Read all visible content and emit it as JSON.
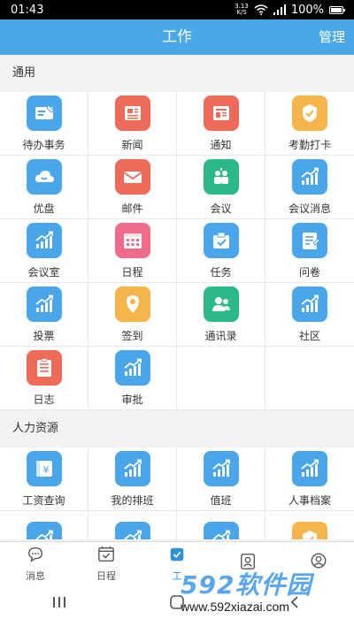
{
  "status": {
    "time": "01:43",
    "speed_value": "3.13",
    "speed_unit": "K/S",
    "battery": "100%",
    "battery_level": 1.0
  },
  "header": {
    "title": "工作",
    "manage_label": "管理"
  },
  "sections": [
    {
      "title": "通用",
      "items": [
        {
          "label": "待办事务",
          "icon": "todo-card-icon",
          "color": "#4aa6e8"
        },
        {
          "label": "新闻",
          "icon": "news-icon",
          "color": "#ee6b5a"
        },
        {
          "label": "通知",
          "icon": "notice-icon",
          "color": "#ee6b5a"
        },
        {
          "label": "考勤打卡",
          "icon": "checkin-icon",
          "color": "#f6b54a"
        },
        {
          "label": "优盘",
          "icon": "cloud-icon",
          "color": "#4aa6e8"
        },
        {
          "label": "邮件",
          "icon": "mail-icon",
          "color": "#ee6b5a"
        },
        {
          "label": "会议",
          "icon": "meeting-icon",
          "color": "#2db88a"
        },
        {
          "label": "会议消息",
          "icon": "chart-icon",
          "color": "#4aa6e8"
        },
        {
          "label": "会议室",
          "icon": "chart-icon",
          "color": "#4aa6e8"
        },
        {
          "label": "日程",
          "icon": "calendar-icon",
          "color": "#ee6b8a"
        },
        {
          "label": "任务",
          "icon": "task-icon",
          "color": "#4aa6e8"
        },
        {
          "label": "问卷",
          "icon": "survey-icon",
          "color": "#4aa6e8"
        },
        {
          "label": "投票",
          "icon": "chart-icon",
          "color": "#4aa6e8"
        },
        {
          "label": "签到",
          "icon": "location-icon",
          "color": "#f6b54a"
        },
        {
          "label": "通讯录",
          "icon": "contacts-icon",
          "color": "#2db88a"
        },
        {
          "label": "社区",
          "icon": "chart-icon",
          "color": "#4aa6e8"
        },
        {
          "label": "日志",
          "icon": "log-icon",
          "color": "#ee6b5a"
        },
        {
          "label": "审批",
          "icon": "chart-icon",
          "color": "#4aa6e8"
        }
      ]
    },
    {
      "title": "人力资源",
      "items": [
        {
          "label": "工资查询",
          "icon": "salary-icon",
          "color": "#4aa6e8"
        },
        {
          "label": "我的排班",
          "icon": "chart-icon",
          "color": "#4aa6e8"
        },
        {
          "label": "值班",
          "icon": "chart-icon",
          "color": "#4aa6e8"
        },
        {
          "label": "人事档案",
          "icon": "chart-icon",
          "color": "#4aa6e8"
        },
        {
          "label": "",
          "icon": "chart-icon",
          "color": "#4aa6e8"
        },
        {
          "label": "",
          "icon": "chart-icon",
          "color": "#4aa6e8"
        },
        {
          "label": "",
          "icon": "chart-icon",
          "color": "#4aa6e8"
        },
        {
          "label": "",
          "icon": "checkin-icon",
          "color": "#f6b54a"
        }
      ]
    }
  ],
  "tabs": [
    {
      "label": "消息",
      "icon": "message-icon",
      "active": false
    },
    {
      "label": "日程",
      "icon": "calendar-tab-icon",
      "active": false
    },
    {
      "label": "工",
      "icon": "work-icon",
      "active": true
    },
    {
      "label": "",
      "icon": "contacts-tab-icon",
      "active": false
    },
    {
      "label": "",
      "icon": "profile-icon",
      "active": false
    }
  ],
  "colors": {
    "accent": "#4aa8e8",
    "active_tab": "#2f8fd8"
  },
  "watermark": {
    "main": "592软件园",
    "sub": "www.592xiazai.com"
  }
}
